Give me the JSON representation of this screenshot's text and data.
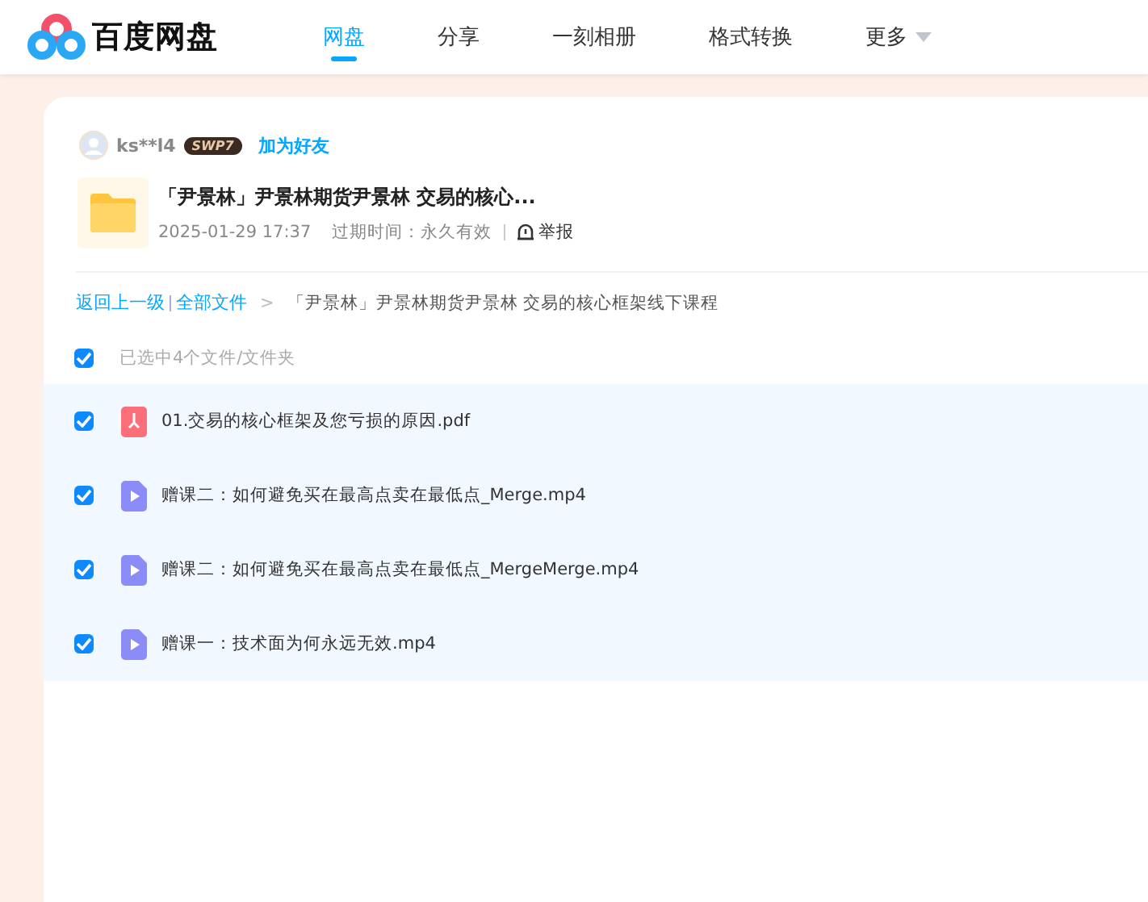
{
  "brand": {
    "name": "百度网盘"
  },
  "nav": [
    {
      "label": "网盘",
      "selected": true
    },
    {
      "label": "分享",
      "selected": false
    },
    {
      "label": "一刻相册",
      "selected": false
    },
    {
      "label": "格式转换",
      "selected": false
    },
    {
      "label": "更多",
      "selected": false,
      "dropdown": true
    }
  ],
  "sharer": {
    "name": "ks**l4",
    "badge": "SWP7",
    "add_friend": "加为好友"
  },
  "share": {
    "title": "「尹景林」尹景林期货尹景林 交易的核心...",
    "date": "2025-01-29 17:37",
    "expiry": "过期时间：永久有效",
    "report": "举报"
  },
  "breadcrumb": {
    "back": "返回上一级",
    "root": "全部文件",
    "separator": ">",
    "current": "「尹景林」尹景林期货尹景林 交易的核心框架线下课程"
  },
  "select_all": {
    "label": "已选中4个文件/文件夹",
    "checked": true
  },
  "files": [
    {
      "name": "01.交易的核心框架及您亏损的原因.pdf",
      "kind": "pdf",
      "checked": true
    },
    {
      "name": "赠课二：如何避免买在最高点卖在最低点_Merge.mp4",
      "kind": "video",
      "checked": true
    },
    {
      "name": "赠课二：如何避免买在最高点卖在最低点_MergeMerge.mp4",
      "kind": "video",
      "checked": true
    },
    {
      "name": "赠课一：技术面为何永远无效.mp4",
      "kind": "video",
      "checked": true
    }
  ]
}
